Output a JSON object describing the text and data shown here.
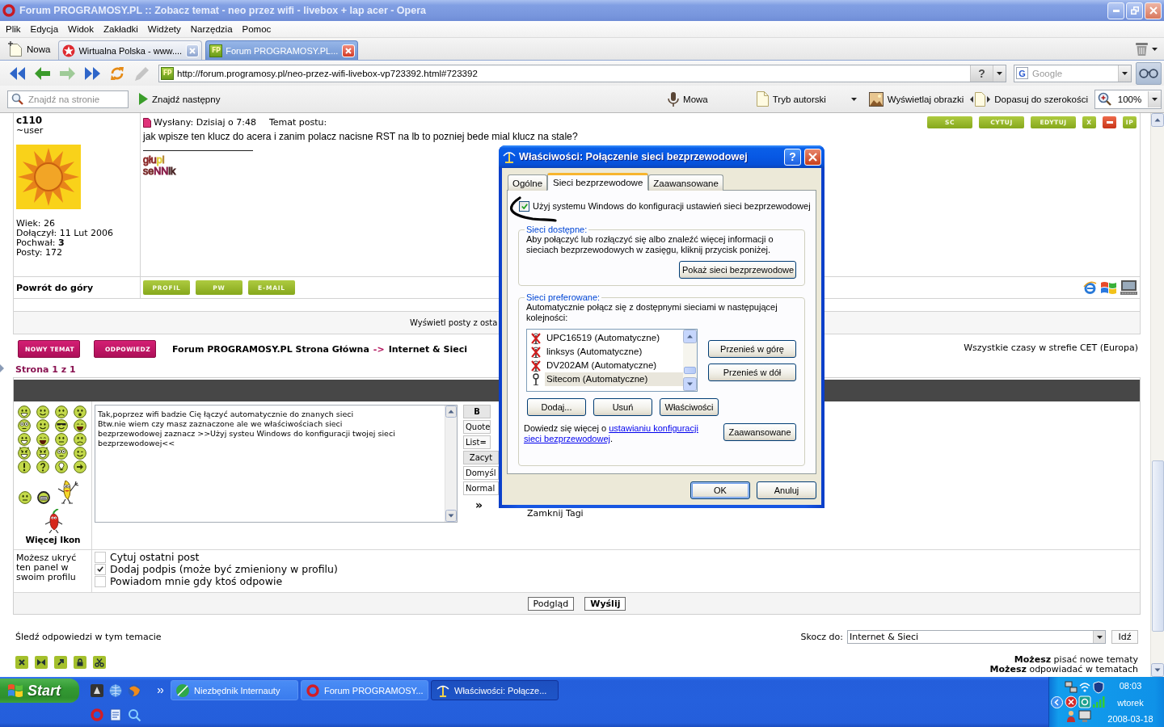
{
  "window": {
    "title": "Forum PROGRAMOSY.PL :: Zobacz temat - neo przez wifi - livebox + lap acer - Opera"
  },
  "menu": [
    "Plik",
    "Edycja",
    "Widok",
    "Zakładki",
    "Widżety",
    "Narzędzia",
    "Pomoc"
  ],
  "new_tab": {
    "label": "Nowa"
  },
  "tabs": [
    {
      "kind": "portal",
      "label": "Wirtualna Polska - www....",
      "selected": false
    },
    {
      "kind": "site",
      "favicon": "FP",
      "label": "Forum PROGRAMOSY.PL...",
      "selected": true
    }
  ],
  "nav_buttons": [
    {
      "kind": "rewind",
      "disabled": false
    },
    {
      "kind": "back",
      "disabled": false
    },
    {
      "kind": "forward",
      "disabled": true
    },
    {
      "kind": "fast_forward",
      "disabled": false
    },
    {
      "kind": "reload",
      "disabled": false
    },
    {
      "kind": "edit",
      "disabled": true
    }
  ],
  "address_bar": {
    "favicon": "FP",
    "url": "http://forum.programosy.pl/neo-przez-wifi-livebox-vp723392.html#723392",
    "help_label": "?"
  },
  "search_field": {
    "logo": "G",
    "placeholder": "Google"
  },
  "find_bar": {
    "placeholder": "Znajdź na stronie",
    "next_label": "Znajdź następny"
  },
  "view_tools": [
    {
      "kind": "voice",
      "label": "Mowa",
      "dropdown": false
    },
    {
      "kind": "author",
      "label": "Tryb autorski",
      "dropdown": true
    },
    {
      "kind": "images",
      "label": "Wyświetlaj obrazki",
      "dropdown": false
    },
    {
      "kind": "fit",
      "label": "Dopasuj do szerokości",
      "dropdown": false
    }
  ],
  "zoom": {
    "value": "100%"
  },
  "post": {
    "author": "c110",
    "rank": "~user",
    "profile": [
      "Wiek: 26",
      "Dołączył: 11 Lut 2006",
      "Pochwał: **3**",
      "Posty: 172"
    ],
    "posted": "Wysłany: Dzisiaj o 7:48",
    "subject_label": "Temat postu:",
    "actions": [
      {
        "kind": "wide",
        "label": "SC"
      },
      {
        "kind": "wide",
        "label": "CYTUJ"
      },
      {
        "kind": "wide",
        "label": "EDYTUJ"
      },
      {
        "kind": "small",
        "label": "X"
      },
      {
        "kind": "delete"
      },
      {
        "kind": "small",
        "label": "IP"
      }
    ],
    "body": "jak wpisze ten klucz do acera i zanim polacz nacisne RST na lb to pozniej bede mial klucz na stale?",
    "signature": [
      {
        "segments": [
          {
            "text": "głu",
            "color": "#8e2d2d"
          },
          {
            "text": "p",
            "color": "#e2cf3a"
          },
          {
            "text": "i",
            "color": "#b5873a"
          }
        ]
      },
      {
        "segments": [
          {
            "text": "se",
            "color": "#7a2c2c"
          },
          {
            "text": "NN",
            "color": "#8a1f4a"
          },
          {
            "text": "ik",
            "color": "#4a2626"
          }
        ]
      }
    ],
    "back_to_top": "Powrót do góry",
    "contact_buttons": [
      "PROFIL",
      "PW",
      "E-MAIL"
    ],
    "view_posts": "Wyświetl posty z osta"
  },
  "nav": {
    "buttons": [
      "NOWY TEMAT",
      "ODPOWIEDZ"
    ],
    "home_link": "Forum PROGRAMOSY.PL Strona Główna",
    "separator": "->",
    "forum_link": "Internet & Sieci",
    "timezone": "Wszystkie czasy w strefie CET (Europa)",
    "pagination": "Strona 1 z 1"
  },
  "reply": {
    "more_icons": "Więcej Ikon",
    "message": "Tak,poprzez wifi badzie Cię łączyć automatycznie do znanych sieci\nBtw.nie wiem czy masz zaznaczone ale we właściwościach sieci\nbezprzewodowej zaznacz >>Użyj systeu Windows do konfiguracji twojej sieci\nbezprzewodowej<<",
    "format_buttons": [
      {
        "kind": "bold",
        "label": "B"
      },
      {
        "kind": "tag",
        "label": "Quote"
      },
      {
        "kind": "tag",
        "label": "List="
      },
      {
        "kind": "button",
        "label": "Zacyt"
      },
      {
        "kind": "select",
        "label": "Domyśl"
      },
      {
        "kind": "select",
        "label": "Normal"
      }
    ],
    "more": "»",
    "close_tags": "Zamknij Tagi",
    "panel_hint": "Możesz ukryć ten panel w swoim profilu",
    "options": [
      {
        "label": "Cytuj ostatni post",
        "checked": false
      },
      {
        "label": "Dodaj podpis (może być zmieniony w profilu)",
        "checked": true
      },
      {
        "label": "Powiadom mnie gdy ktoś odpowie",
        "checked": false
      }
    ],
    "submit": [
      {
        "label": "Podgląd",
        "primary": false
      },
      {
        "label": "Wyślij",
        "primary": true
      }
    ]
  },
  "footer": {
    "watch_link": "Śledź odpowiedzi w tym temacie",
    "jump_label": "Skocz do:",
    "jump_value": "Internet & Sieci",
    "go_label": "Idź",
    "permissions": [
      "**Możesz** pisać nowe tematy",
      "**Możesz** odpowiadać w tematach"
    ]
  },
  "dialog": {
    "title": "Właściwości: Połączenie sieci bezprzewodowej",
    "help_label": "?",
    "tabs": [
      {
        "label": "Ogólne",
        "selected": false
      },
      {
        "label": "Sieci bezprzewodowe",
        "selected": true
      },
      {
        "label": "Zaawansowane",
        "selected": false
      }
    ],
    "use_windows": {
      "label": "Użyj systemu Windows do konfiguracji ustawień sieci bezprzewodowej",
      "checked": true
    },
    "available": {
      "legend": "Sieci dostępne:",
      "text": "Aby połączyć lub rozłączyć się albo znaleźć więcej informacji o sieciach bezprzewodowych w zasięgu, kliknij przycisk poniżej.",
      "button": "Pokaż sieci bezprzewodowe"
    },
    "preferred": {
      "legend": "Sieci preferowane:",
      "text": "Automatycznie połącz się z dostępnymi sieciami w następującej kolejności:",
      "networks": [
        {
          "name": "UPC16519 (Automatyczne)",
          "kind": "unavailable",
          "selected": false
        },
        {
          "name": "linksys (Automatyczne)",
          "kind": "unavailable",
          "selected": false
        },
        {
          "name": "DV202AM (Automatyczne)",
          "kind": "unavailable",
          "selected": false
        },
        {
          "name": "Sitecom (Automatyczne)",
          "kind": "available",
          "selected": true
        }
      ],
      "move_buttons": [
        "Przenieś w górę",
        "Przenieś w dół"
      ],
      "list_buttons": [
        "Dodaj...",
        "Usuń",
        "Właściwości"
      ],
      "learn_more": {
        "text": "Dowiedz się więcej o",
        "link_lines": [
          "ustawianiu konfiguracji",
          "sieci bezprzewodowej"
        ],
        "end": "."
      },
      "advanced_button": "Zaawansowane"
    },
    "buttons": [
      {
        "label": "OK",
        "default": true
      },
      {
        "label": "Anuluj",
        "default": false
      }
    ]
  },
  "taskbar": {
    "start": "Start",
    "tasks": [
      {
        "kind": "toolkit",
        "label": "Niezbędnik Internauty",
        "selected": false
      },
      {
        "kind": "browser",
        "label": "Forum PROGRAMOSY...",
        "selected": false
      },
      {
        "kind": "network",
        "label": "Właściwości: Połącze...",
        "selected": true
      }
    ],
    "clock": {
      "time": "08:03",
      "day": "wtorek",
      "date": "2008-03-18"
    }
  }
}
